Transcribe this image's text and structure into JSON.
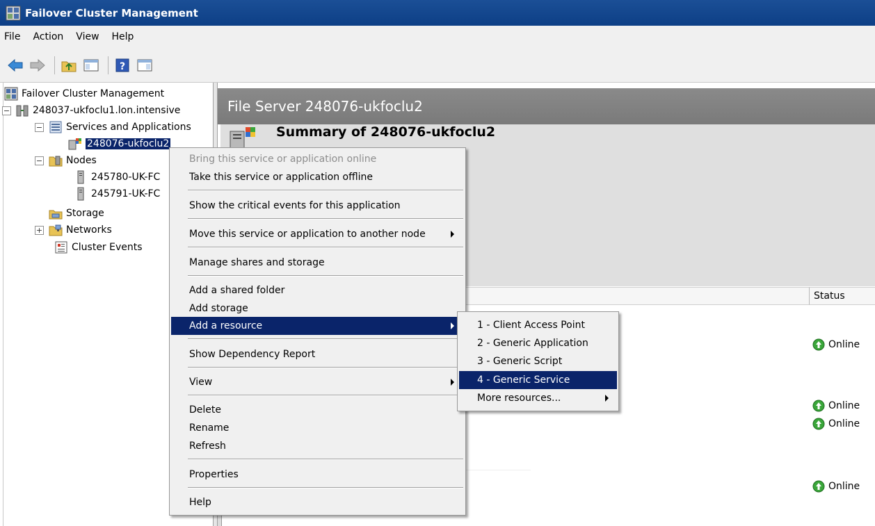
{
  "window": {
    "title": "Failover Cluster Management"
  },
  "menubar": {
    "items": [
      "File",
      "Action",
      "View",
      "Help"
    ]
  },
  "toolbar": {
    "icons": [
      "back-icon",
      "forward-icon",
      "up-folder-icon",
      "show-hide-tree-icon",
      "help-icon",
      "show-hide-action-pane-icon"
    ]
  },
  "tree": {
    "root": "Failover Cluster Management",
    "cluster": "248037-ukfoclu1.lon.intensive",
    "services": "Services and Applications",
    "service_item": "248076-ukfoclu2",
    "nodes": "Nodes",
    "node1": "245780-UK-FC",
    "node2": "245791-UK-FC",
    "storage": "Storage",
    "networks": "Networks",
    "events": "Cluster Events"
  },
  "content": {
    "header": "File Server 248076-ukfoclu2",
    "summary_title": "Summary of 248076-ukfoclu2",
    "status_header": "Status",
    "statuses": [
      "Online",
      "Online",
      "Online",
      "Online"
    ]
  },
  "context_menu": {
    "bring_online": "Bring this service or application online",
    "take_offline": "Take this service or application offline",
    "critical_events": "Show the critical events for this application",
    "move": "Move this service or application to another node",
    "manage_shares": "Manage shares and storage",
    "add_shared_folder": "Add a shared folder",
    "add_storage": "Add storage",
    "add_resource": "Add a resource",
    "dependency_report": "Show Dependency Report",
    "view": "View",
    "delete": "Delete",
    "rename": "Rename",
    "refresh": "Refresh",
    "properties": "Properties",
    "help": "Help"
  },
  "submenu": {
    "client_access_point": "1 - Client Access Point",
    "generic_application": "2 - Generic Application",
    "generic_script": "3 - Generic Script",
    "generic_service": "4 - Generic Service",
    "more_resources": "More resources..."
  },
  "colors": {
    "titlebar": "#0d3f86",
    "selection": "#0a246a",
    "header_band": "#808080",
    "summary_panel": "#dfdfdf"
  }
}
